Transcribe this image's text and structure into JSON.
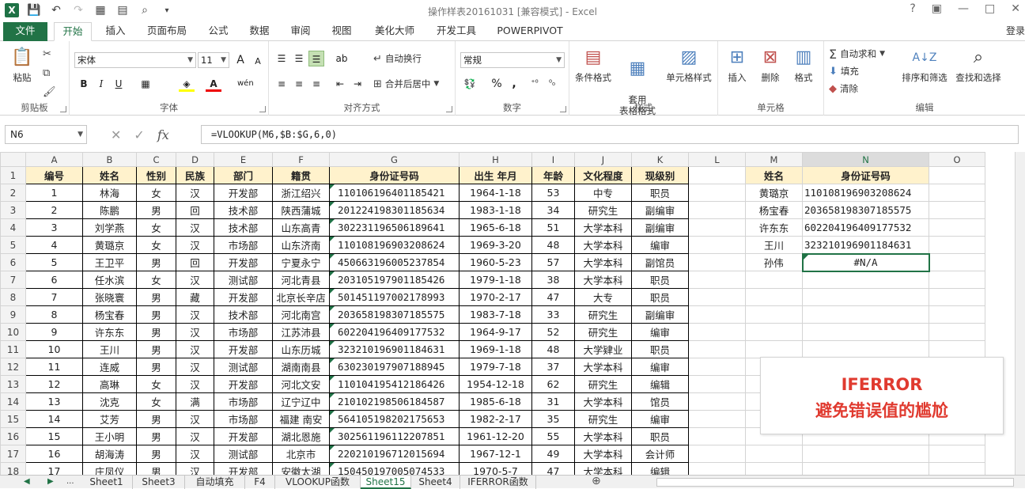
{
  "window": {
    "title": "操作样表20161031  [兼容模式] - Excel",
    "help": "?",
    "controls": [
      "—",
      "□",
      "✕"
    ],
    "ribbon_toggle": "▣"
  },
  "qat": {
    "logo": "X"
  },
  "tabs": [
    {
      "label": "文件"
    },
    {
      "label": "开始"
    },
    {
      "label": "插入"
    },
    {
      "label": "页面布局"
    },
    {
      "label": "公式"
    },
    {
      "label": "数据"
    },
    {
      "label": "审阅"
    },
    {
      "label": "视图"
    },
    {
      "label": "美化大师"
    },
    {
      "label": "开发工具"
    },
    {
      "label": "POWERPIVOT"
    }
  ],
  "signin": "登录",
  "ribbon": {
    "clipboard": {
      "label": "剪贴板",
      "paste": "粘贴"
    },
    "font": {
      "label": "字体",
      "name": "宋体",
      "size": "11",
      "bold": "B",
      "italic": "I",
      "underline": "U",
      "grow": "A",
      "shrink": "A",
      "phonetic": "wén"
    },
    "alignment": {
      "label": "对齐方式",
      "wrap": "自动换行",
      "merge": "合并后居中"
    },
    "number": {
      "label": "数字",
      "format": "常规",
      "percent": "%",
      "comma": ","
    },
    "styles": {
      "label": "样式",
      "conditional": "条件格式",
      "table": "套用\n表格格式",
      "cell": "单元格样式"
    },
    "cells": {
      "label": "单元格",
      "insert": "插入",
      "delete": "删除",
      "format": "格式"
    },
    "editing": {
      "label": "编辑",
      "autosum": "自动求和",
      "fill": "填充",
      "clear": "清除",
      "sort": "排序和筛选",
      "find": "查找和选择"
    }
  },
  "formula_bar": {
    "cell": "N6",
    "formula": "=VLOOKUP(M6,$B:$G,6,0)",
    "fx": "fx"
  },
  "columns": [
    "A",
    "B",
    "C",
    "D",
    "E",
    "F",
    "G",
    "H",
    "I",
    "J",
    "K",
    "L",
    "M",
    "N",
    "O"
  ],
  "headers": [
    "编号",
    "姓名",
    "性别",
    "民族",
    "部门",
    "籍贯",
    "身份证号码",
    "出生 年月",
    "年龄",
    "文化程度",
    "现级别"
  ],
  "rows": [
    [
      "1",
      "林海",
      "女",
      "汉",
      "开发部",
      "浙江绍兴",
      "110106196401185421",
      "1964-1-18",
      "53",
      "中专",
      "职员"
    ],
    [
      "2",
      "陈鹏",
      "男",
      "回",
      "技术部",
      "陕西蒲城",
      "201224198301185634",
      "1983-1-18",
      "34",
      "研究生",
      "副编审"
    ],
    [
      "3",
      "刘学燕",
      "女",
      "汉",
      "技术部",
      "山东高青",
      "302231196506189641",
      "1965-6-18",
      "51",
      "大学本科",
      "副编审"
    ],
    [
      "4",
      "黄璐京",
      "女",
      "汉",
      "市场部",
      "山东济南",
      "110108196903208624",
      "1969-3-20",
      "48",
      "大学本科",
      "编审"
    ],
    [
      "5",
      "王卫平",
      "男",
      "回",
      "开发部",
      "宁夏永宁",
      "450663196005237854",
      "1960-5-23",
      "57",
      "大学本科",
      "副馆员"
    ],
    [
      "6",
      "任水滨",
      "女",
      "汉",
      "测试部",
      "河北青县",
      "203105197901185426",
      "1979-1-18",
      "38",
      "大学本科",
      "职员"
    ],
    [
      "7",
      "张晓寰",
      "男",
      "藏",
      "开发部",
      "北京长辛店",
      "501451197002178993",
      "1970-2-17",
      "47",
      "大专",
      "职员"
    ],
    [
      "8",
      "杨宝春",
      "男",
      "汉",
      "技术部",
      "河北南宫",
      "203658198307185575",
      "1983-7-18",
      "33",
      "研究生",
      "副编审"
    ],
    [
      "9",
      "许东东",
      "男",
      "汉",
      "市场部",
      "江苏沛县",
      "602204196409177532",
      "1964-9-17",
      "52",
      "研究生",
      "编审"
    ],
    [
      "10",
      "王川",
      "男",
      "汉",
      "开发部",
      "山东历城",
      "323210196901184631",
      "1969-1-18",
      "48",
      "大学肄业",
      "职员"
    ],
    [
      "11",
      "连威",
      "男",
      "汉",
      "测试部",
      "湖南南县",
      "630230197907188945",
      "1979-7-18",
      "37",
      "大学本科",
      "编审"
    ],
    [
      "12",
      "高琳",
      "女",
      "汉",
      "开发部",
      "河北文安",
      "110104195412186426",
      "1954-12-18",
      "62",
      "研究生",
      "编辑"
    ],
    [
      "13",
      "沈克",
      "女",
      "满",
      "市场部",
      "辽宁辽中",
      "210102198506184587",
      "1985-6-18",
      "31",
      "大学本科",
      "馆员"
    ],
    [
      "14",
      "艾芳",
      "男",
      "汉",
      "市场部",
      "福建 南安",
      "564105198202175653",
      "1982-2-17",
      "35",
      "研究生",
      "编审"
    ],
    [
      "15",
      "王小明",
      "男",
      "汉",
      "开发部",
      "湖北恩施",
      "302561196112207851",
      "1961-12-20",
      "55",
      "大学本科",
      "职员"
    ],
    [
      "16",
      "胡海涛",
      "男",
      "汉",
      "测试部",
      "北京市",
      "220210196712015694",
      "1967-12-1",
      "49",
      "大学本科",
      "会计师"
    ],
    [
      "17",
      "庄凤仪",
      "男",
      "汉",
      "开发部",
      "安徽太湖",
      "150450197005074533",
      "1970-5-7",
      "47",
      "大学本科",
      "编辑"
    ]
  ],
  "lookup": {
    "headers": [
      "姓名",
      "身份证号码"
    ],
    "rows": [
      [
        "黄璐京",
        "110108196903208624"
      ],
      [
        "杨宝春",
        "203658198307185575"
      ],
      [
        "许东东",
        "602204196409177532"
      ],
      [
        "王川",
        "323210196901184631"
      ],
      [
        "孙伟",
        "#N/A"
      ]
    ]
  },
  "callout": {
    "line1": "IFERROR",
    "line2": "避免错误值的尴尬"
  },
  "sheets": [
    "Sheet1",
    "Sheet3",
    "自动填充",
    "F4",
    "VLOOKUP函数",
    "Sheet15",
    "Sheet4",
    "IFERROR函数"
  ],
  "active_sheet": "Sheet15",
  "sheet_nav": {
    "prev": "◀",
    "next": "▶",
    "more": "...",
    "add": "⊕"
  }
}
